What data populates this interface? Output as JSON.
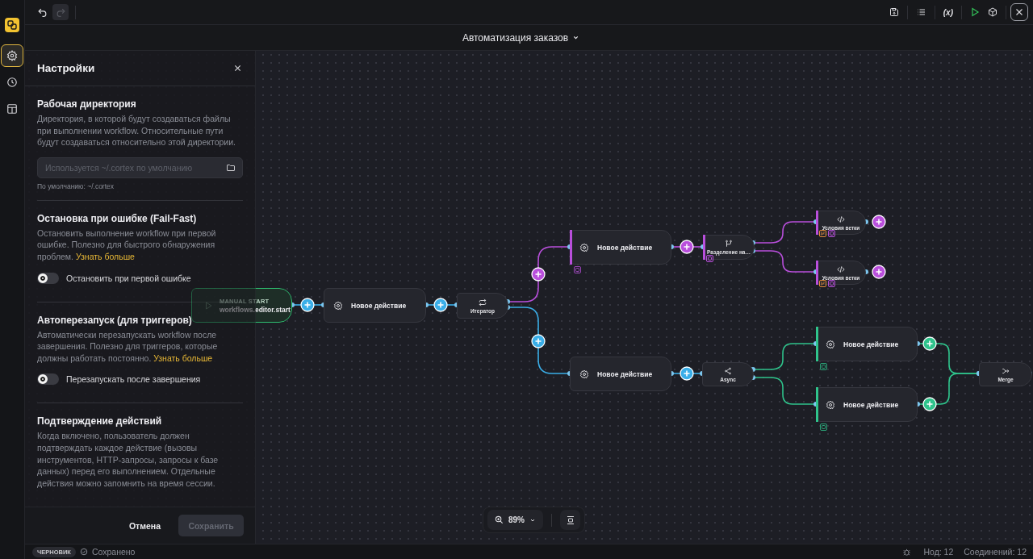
{
  "toolbar": {
    "undo": {
      "disabled": false
    },
    "redo": {
      "disabled": true
    },
    "actions": [
      {
        "kind": "save"
      },
      {
        "kind": "list"
      },
      {
        "kind": "variables",
        "label": "(x)"
      },
      {
        "kind": "run"
      },
      {
        "kind": "package"
      },
      {
        "kind": "close"
      }
    ]
  },
  "title": "Автоматизация заказов",
  "rail": [
    {
      "kind": "settings",
      "selected": true
    },
    {
      "kind": "history",
      "selected": false
    },
    {
      "kind": "layout",
      "selected": false
    }
  ],
  "settings_panel": {
    "title": "Настройки",
    "sections": [
      {
        "title": "Рабочая директория",
        "description": "Директория, в которой будут создаваться файлы при выполнении workflow. Относительные пути будут создаваться относительно этой директории.",
        "field": {
          "placeholder": "Используется ~/.cortex по умолчанию",
          "hint": "По умолчанию: ~/.cortex"
        }
      },
      {
        "title": "Остановка при ошибке (Fail-Fast)",
        "description": "Остановить выполнение workflow при первой ошибке. Полезно для быстрого обнаружения проблем.",
        "link": "Узнать больше",
        "toggle": {
          "label": "Остановить при первой ошибке",
          "on": false
        }
      },
      {
        "title": "Автоперезапуск (для триггеров)",
        "description": "Автоматически перезапускать workflow после завершения. Полезно для триггеров, которые должны работать постоянно.",
        "link": "Узнать больше",
        "toggle": {
          "label": "Перезапускать после завершения",
          "on": false
        }
      },
      {
        "title": "Подтверждение действий",
        "description": "Когда включено, пользователь должен подтверждать каждое действие (вызовы инструментов, HTTP-запросы, запросы к базе данных) перед его выполнением. Отдельные действия можно запомнить на время сессии."
      }
    ],
    "cancel_button": "Отмена",
    "save_button": {
      "label": "Сохранить",
      "disabled": true
    }
  },
  "canvas": {
    "nodes": [
      {
        "kind": "trigger",
        "caption": "MANUAL START",
        "label": "workflows.editor.start"
      },
      {
        "kind": "action",
        "label": "Новое действие"
      },
      {
        "kind": "iterator",
        "label": "Итератор"
      },
      {
        "kind": "action",
        "label": "Новое действие",
        "color": "#b94fdc"
      },
      {
        "kind": "split",
        "label": "Разделение на…",
        "color": "#b94fdc"
      },
      {
        "kind": "condition",
        "label": "Условия ветки",
        "color": "#b94fdc"
      },
      {
        "kind": "condition",
        "label": "Условия ветки",
        "color": "#b94fdc"
      },
      {
        "kind": "action",
        "label": "Новое действие"
      },
      {
        "kind": "async",
        "label": "Async"
      },
      {
        "kind": "action",
        "label": "Новое действие",
        "color": "#2fc48c"
      },
      {
        "kind": "action",
        "label": "Новое действие",
        "color": "#2fc48c"
      },
      {
        "kind": "merge",
        "label": "Merge"
      }
    ],
    "connections": [
      {
        "color": "#3aaee8"
      },
      {
        "color": "#3aaee8"
      },
      {
        "color": "#b94fdc"
      },
      {
        "color": "#3aaee8"
      },
      {
        "color": "#b94fdc"
      },
      {
        "color": "#b94fdc"
      },
      {
        "color": "#b94fdc"
      },
      {
        "color": "#3aaee8"
      },
      {
        "color": "#2fc48c"
      },
      {
        "color": "#2fc48c"
      },
      {
        "color": "#2fc48c"
      },
      {
        "color": "#2fc48c"
      }
    ],
    "add_buttons": [
      {
        "color": "#3aaee8"
      },
      {
        "color": "#3aaee8"
      },
      {
        "color": "#b94fdc"
      },
      {
        "color": "#3aaee8"
      },
      {
        "color": "#b94fdc"
      },
      {
        "color": "#3aaee8"
      },
      {
        "color": "#b94fdc"
      },
      {
        "color": "#b94fdc"
      },
      {
        "color": "#2fc48c"
      },
      {
        "color": "#2fc48c"
      }
    ]
  },
  "zoom": {
    "value": "89%"
  },
  "status_bar": {
    "badge": "ЧЕРНОВИК",
    "save_state": "Сохранено",
    "nodes": "Нод: 12",
    "connections": "Соединений: 12"
  }
}
